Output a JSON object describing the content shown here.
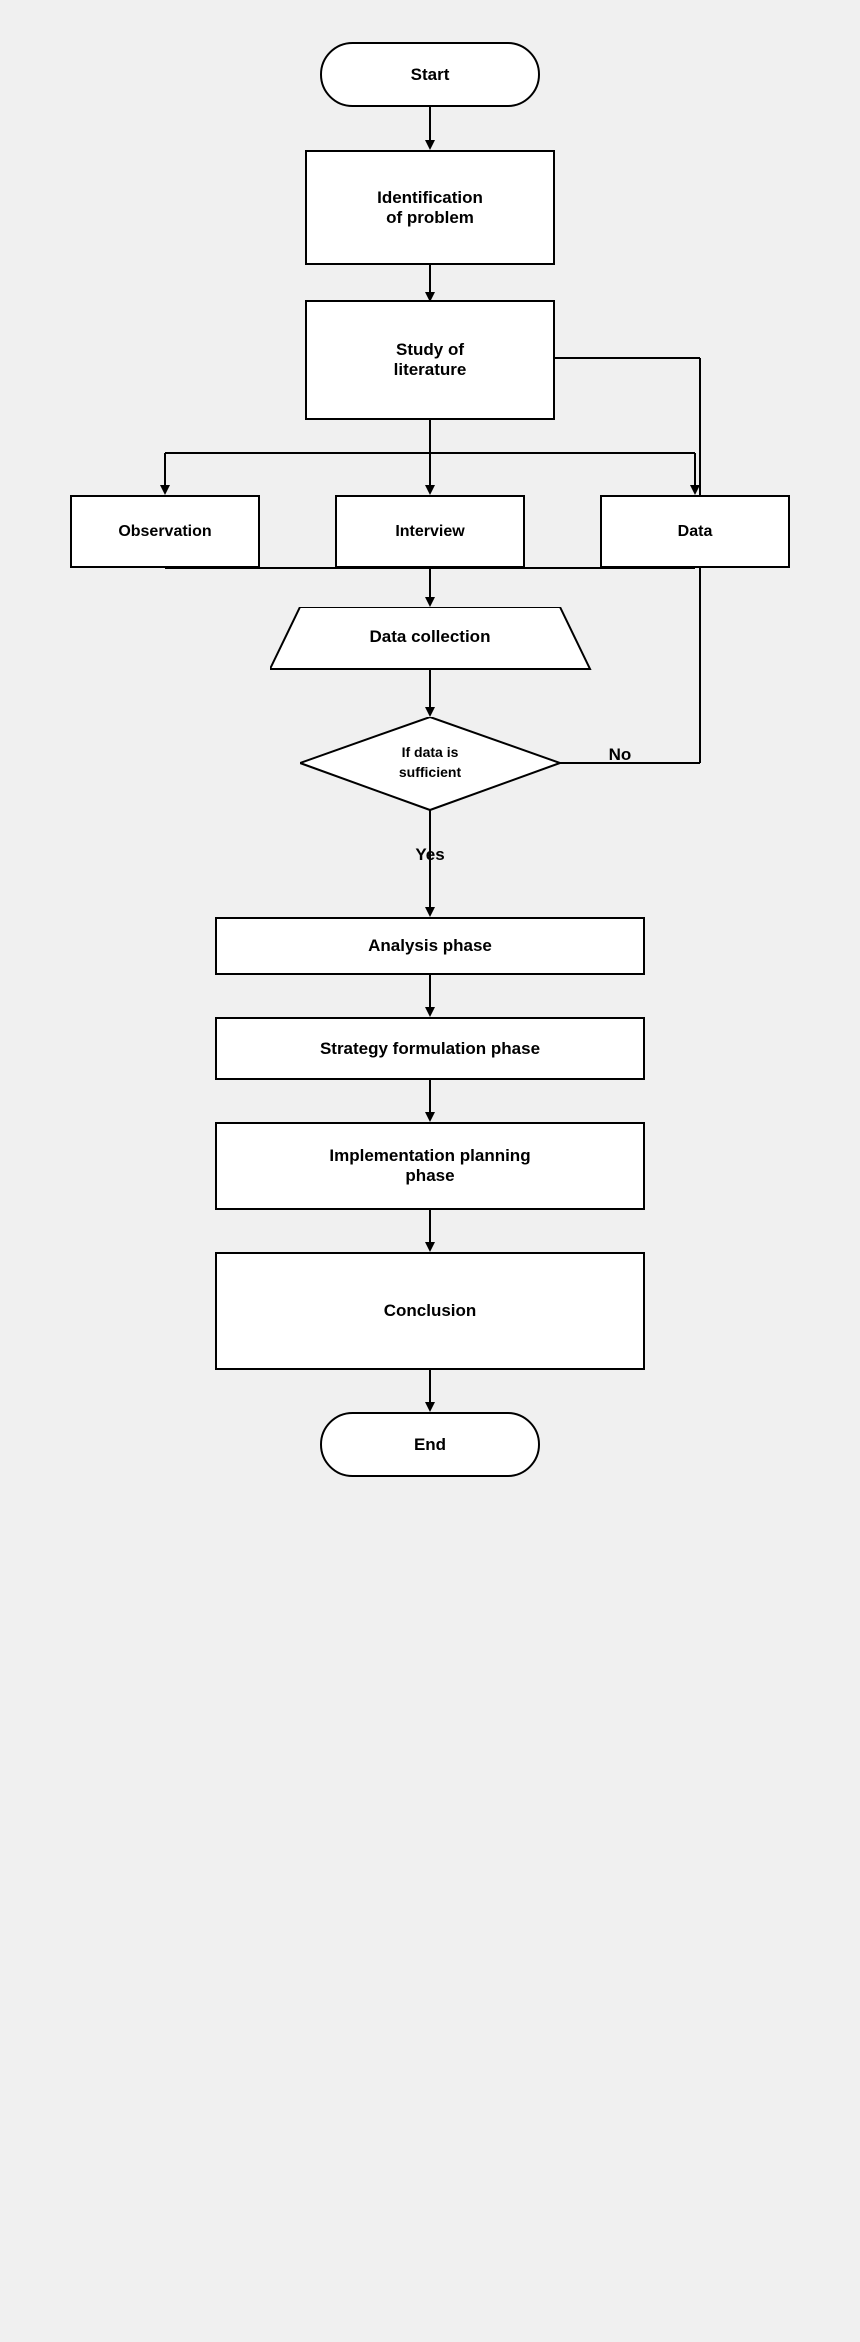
{
  "nodes": {
    "start": {
      "label": "Start"
    },
    "identification": {
      "label": "Identification\nof problem"
    },
    "study": {
      "label": "Study of\nliterature"
    },
    "observation": {
      "label": "Observation"
    },
    "interview": {
      "label": "Interview"
    },
    "data": {
      "label": "Data"
    },
    "data_collection": {
      "label": "Data collection"
    },
    "diamond": {
      "label": "If data is\nsufficient"
    },
    "no_label": {
      "label": "No"
    },
    "yes_label": {
      "label": "Yes"
    },
    "analysis": {
      "label": "Analysis phase"
    },
    "strategy": {
      "label": "Strategy formulation phase"
    },
    "implementation": {
      "label": "Implementation planning\nphase"
    },
    "conclusion": {
      "label": "Conclusion"
    },
    "end": {
      "label": "End"
    }
  }
}
